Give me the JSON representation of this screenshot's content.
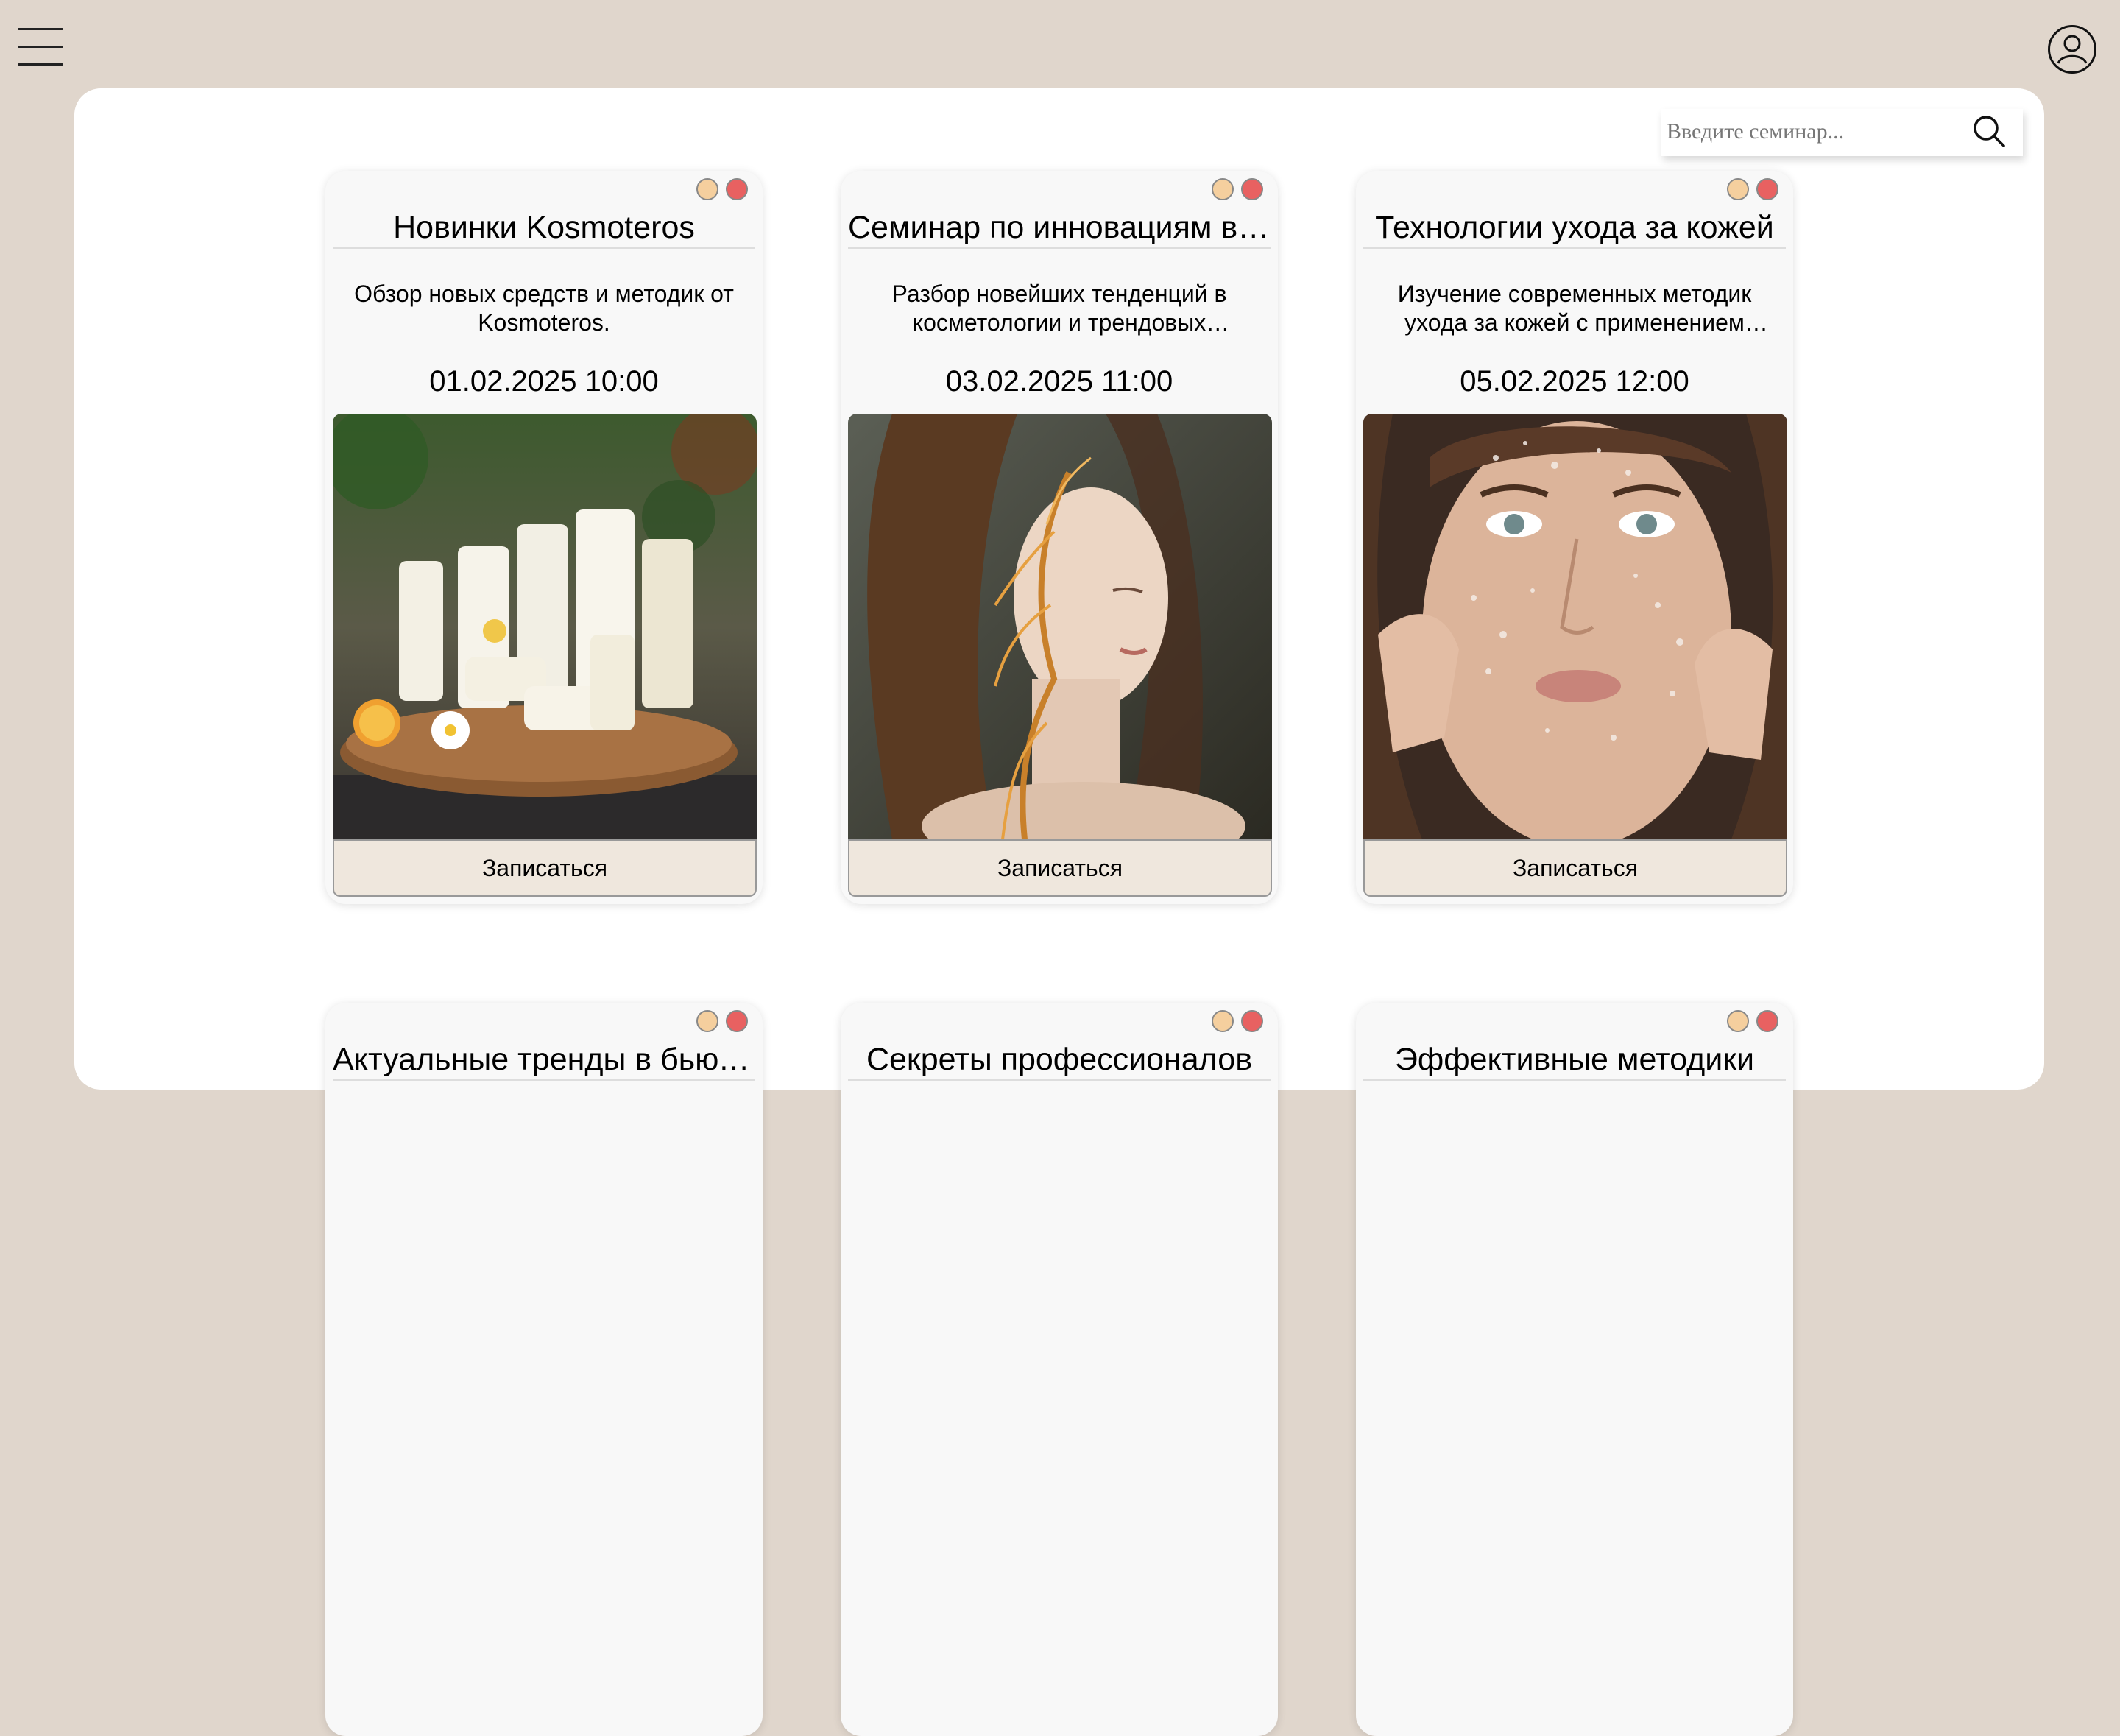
{
  "search": {
    "placeholder": "Введите семинар..."
  },
  "seminars": [
    {
      "title": "Новинки Kosmoteros",
      "description": "Обзор новых средств и методик от Kosmoteros.",
      "date": "01.02.2025 10:00",
      "button": "Записаться"
    },
    {
      "title": "Семинар по инновациям в косметологии",
      "description": "Разбор новейших тенденций в косметологии и трендовых процедур.",
      "date": "03.02.2025 11:00",
      "button": "Записаться"
    },
    {
      "title": "Технологии ухода за кожей",
      "description": "Изучение современных методик ухода за кожей с применением новых технологий.",
      "date": "05.02.2025 12:00",
      "button": "Записаться"
    },
    {
      "title": "Актуальные тренды в бьюти-индустрии"
    },
    {
      "title": "Секреты профессионалов"
    },
    {
      "title": "Эффективные методики"
    }
  ],
  "icons": {
    "menu": "hamburger-menu-icon",
    "profile": "user-profile-icon",
    "search": "search-icon",
    "minimize": "minimize-dot-icon",
    "close": "close-dot-icon"
  },
  "colors": {
    "background": "#e0d6cc",
    "panel": "#ffffff",
    "button": "#efe7dd",
    "peach_dot": "#f5cf9e",
    "red_dot": "#e86161"
  }
}
